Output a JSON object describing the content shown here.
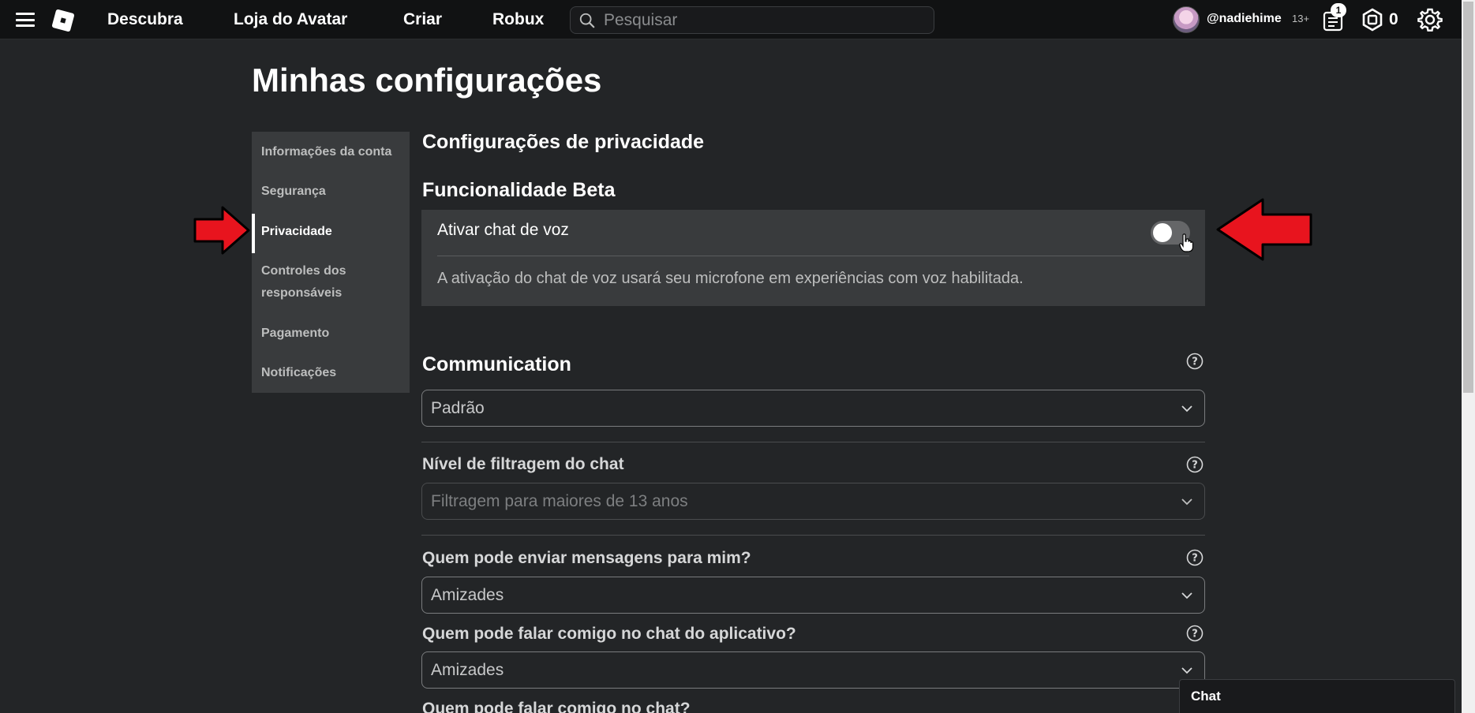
{
  "header": {
    "nav": [
      "Descubra",
      "Loja do Avatar",
      "Criar",
      "Robux"
    ],
    "search_placeholder": "Pesquisar",
    "username": "@nadiehime",
    "age_badge": "13+",
    "notification_count": "1",
    "robux_balance": "0"
  },
  "page": {
    "title": "Minhas configurações"
  },
  "sidebar": {
    "items": [
      {
        "label": "Informações da conta"
      },
      {
        "label": "Segurança"
      },
      {
        "label": "Privacidade",
        "active": true
      },
      {
        "label": "Controles dos responsáveis"
      },
      {
        "label": "Pagamento"
      },
      {
        "label": "Notificações"
      }
    ]
  },
  "privacy": {
    "heading": "Configurações de privacidade",
    "beta_heading": "Funcionalidade Beta",
    "voice_chat_label": "Ativar chat de voz",
    "voice_chat_enabled": false,
    "voice_chat_desc": "A ativação do chat de voz usará seu microfone em experiências com voz habilitada.",
    "communication_heading": "Communication",
    "communication_value": "Padrão",
    "filter_label": "Nível de filtragem do chat",
    "filter_value": "Filtragem para maiores de 13 anos",
    "messages_label": "Quem pode enviar mensagens para mim?",
    "messages_value": "Amizades",
    "app_chat_label": "Quem pode falar comigo no chat do aplicativo?",
    "app_chat_value": "Amizades",
    "chat_label": "Quem pode falar comigo no chat?"
  },
  "chat": {
    "label": "Chat"
  },
  "colors": {
    "background": "#232527",
    "panel": "#393b3d",
    "topbar": "#111213",
    "arrow": "#e8141e"
  }
}
